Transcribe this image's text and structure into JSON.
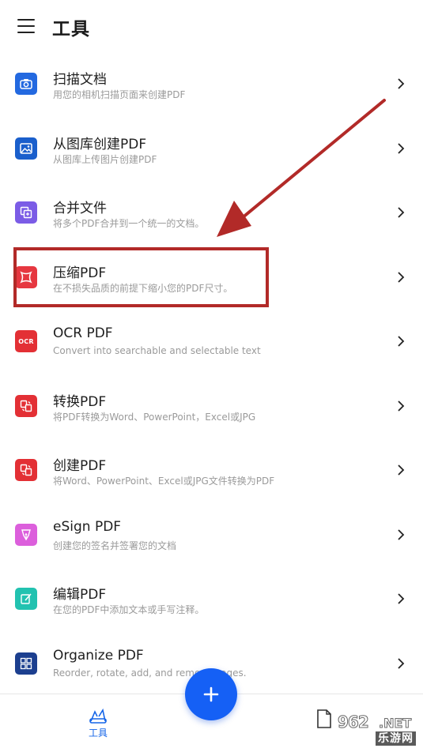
{
  "header": {
    "title": "工具",
    "menu_icon": "hamburger-menu-icon"
  },
  "tools": [
    {
      "title": "扫描文档",
      "desc": "用您的相机扫描页面来创建PDF",
      "icon": "camera-scan-icon",
      "color": "#2369e0"
    },
    {
      "title": "从图库创建PDF",
      "desc": "从图库上传图片创建PDF",
      "icon": "gallery-image-icon",
      "color": "#1a5fcc"
    },
    {
      "title": "合并文件",
      "desc": "将多个PDF合并到一个统一的文档。",
      "icon": "merge-files-icon",
      "color": "#7b5ce6"
    },
    {
      "title": "压缩PDF",
      "desc": "在不损失品质的前提下缩小您的PDF尺寸。",
      "icon": "compress-icon",
      "color": "#e63740"
    },
    {
      "title": "OCR PDF",
      "desc": "Convert into searchable and selectable text",
      "icon": "ocr-icon",
      "icon_text": "OCR",
      "color": "#e33035"
    },
    {
      "title": "转换PDF",
      "desc": "将PDF转换为Word、PowerPoint，Excel或JPG",
      "icon": "convert-icon",
      "color": "#e33035"
    },
    {
      "title": "创建PDF",
      "desc": "将Word、PowerPoint、Excel或JPG文件转换为PDF",
      "icon": "create-pdf-icon",
      "color": "#e33035"
    },
    {
      "title": "eSign PDF",
      "desc": "创建您的签名并签署您的文档",
      "icon": "pen-sign-icon",
      "color": "#dc5fdc"
    },
    {
      "title": "编辑PDF",
      "desc": "在您的PDF中添加文本或手写注释。",
      "icon": "edit-icon",
      "color": "#22c2b0"
    },
    {
      "title": "Organize PDF",
      "desc": "Reorder, rotate, add, and remove pages.",
      "icon": "organize-grid-icon",
      "color": "#1c3f8f"
    }
  ],
  "bottom_nav": {
    "tools_label": "工具",
    "accent": "#1565e8"
  },
  "fab": {
    "icon": "plus-icon",
    "color": "#1560f5"
  },
  "annotation": {
    "color": "#b22a28"
  },
  "watermark": {
    "digits": "962",
    "suffix": ".NET",
    "name": "乐游网"
  }
}
